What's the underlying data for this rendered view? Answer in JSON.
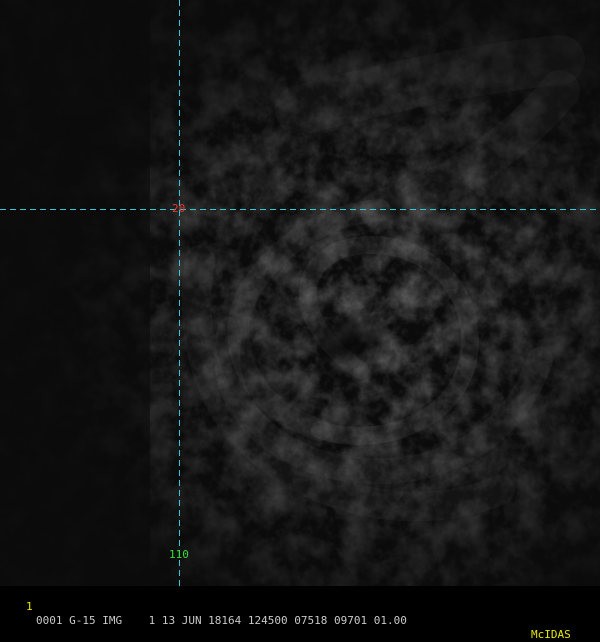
{
  "image": {
    "description_colors": {
      "background": "#0b0b0b",
      "gridline": "#33c8d8"
    }
  },
  "gridlines": {
    "latitude_label": "20",
    "longitude_label": "110",
    "latitude_label_color": "#e03a2a",
    "longitude_label_color": "#33dd33"
  },
  "statusbar": {
    "frame": "1",
    "text": "0001 G-15 IMG    1 13 JUN 18164 124500 07518 09701 01.00",
    "brand": "McIDAS"
  }
}
